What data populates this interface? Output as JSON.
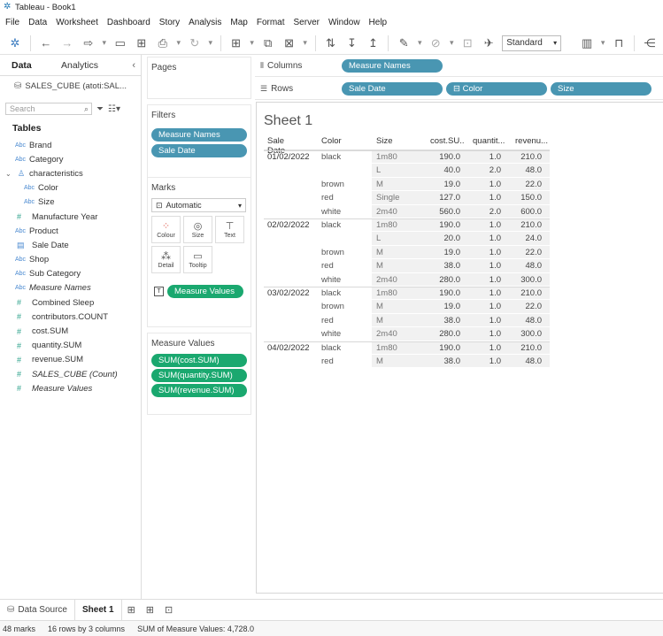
{
  "window": {
    "title": "Tableau - Book1"
  },
  "menu": [
    "File",
    "Data",
    "Worksheet",
    "Dashboard",
    "Story",
    "Analysis",
    "Map",
    "Format",
    "Server",
    "Window",
    "Help"
  ],
  "toolbar": {
    "fit_select": "Standard"
  },
  "left_pane": {
    "tabs": {
      "data": "Data",
      "analytics": "Analytics"
    },
    "datasource": "SALES_CUBE (atoti:SAL...",
    "search_placeholder": "Search",
    "tables_header": "Tables",
    "fields": [
      {
        "type": "Abc",
        "name": "Brand"
      },
      {
        "type": "Abc",
        "name": "Category"
      },
      {
        "type": "hier",
        "name": "characteristics"
      },
      {
        "type": "Abc",
        "name": "Color",
        "child": true
      },
      {
        "type": "Abc",
        "name": "Size",
        "child": true
      },
      {
        "type": "#",
        "name": "Manufacture Year"
      },
      {
        "type": "Abc",
        "name": "Product"
      },
      {
        "type": "date",
        "name": "Sale Date"
      },
      {
        "type": "Abc",
        "name": "Shop"
      },
      {
        "type": "Abc",
        "name": "Sub Category"
      },
      {
        "type": "Abc",
        "name": "Measure Names",
        "italic": true
      },
      {
        "type": "#",
        "name": "Combined Sleep"
      },
      {
        "type": "#",
        "name": "contributors.COUNT"
      },
      {
        "type": "#",
        "name": "cost.SUM"
      },
      {
        "type": "#",
        "name": "quantity.SUM"
      },
      {
        "type": "#",
        "name": "revenue.SUM"
      },
      {
        "type": "#",
        "name": "SALES_CUBE (Count)",
        "italic": true
      },
      {
        "type": "#",
        "name": "Measure Values",
        "italic": true
      }
    ]
  },
  "pages": {
    "title": "Pages"
  },
  "filters": {
    "title": "Filters",
    "items": [
      "Measure Names",
      "Sale Date"
    ]
  },
  "marks": {
    "title": "Marks",
    "type": "Automatic",
    "buttons": [
      "Colour",
      "Size",
      "Text",
      "Detail",
      "Tooltip"
    ],
    "text_pill": "Measure Values"
  },
  "measure_values": {
    "title": "Measure Values",
    "items": [
      "SUM(cost.SUM)",
      "SUM(quantity.SUM)",
      "SUM(revenue.SUM)"
    ]
  },
  "columns": {
    "label": "Columns",
    "pills": [
      "Measure Names"
    ]
  },
  "rows": {
    "label": "Rows",
    "pills": [
      "Sale Date",
      "⊟ Color",
      "Size"
    ]
  },
  "sheet": {
    "title": "Sheet 1",
    "headers": [
      "Sale Date",
      "Color",
      "Size",
      "cost.SU..",
      "quantit...",
      "revenu..."
    ],
    "rows": [
      {
        "date": "01/02/2022",
        "color": "black",
        "size": "1m80",
        "cost": "190.0",
        "qty": "1.0",
        "rev": "210.0"
      },
      {
        "date": "",
        "color": "",
        "size": "L",
        "cost": "40.0",
        "qty": "2.0",
        "rev": "48.0"
      },
      {
        "date": "",
        "color": "brown",
        "size": "M",
        "cost": "19.0",
        "qty": "1.0",
        "rev": "22.0"
      },
      {
        "date": "",
        "color": "red",
        "size": "Single",
        "cost": "127.0",
        "qty": "1.0",
        "rev": "150.0"
      },
      {
        "date": "",
        "color": "white",
        "size": "2m40",
        "cost": "560.0",
        "qty": "2.0",
        "rev": "600.0"
      },
      {
        "date": "02/02/2022",
        "color": "black",
        "size": "1m80",
        "cost": "190.0",
        "qty": "1.0",
        "rev": "210.0"
      },
      {
        "date": "",
        "color": "",
        "size": "L",
        "cost": "20.0",
        "qty": "1.0",
        "rev": "24.0"
      },
      {
        "date": "",
        "color": "brown",
        "size": "M",
        "cost": "19.0",
        "qty": "1.0",
        "rev": "22.0"
      },
      {
        "date": "",
        "color": "red",
        "size": "M",
        "cost": "38.0",
        "qty": "1.0",
        "rev": "48.0"
      },
      {
        "date": "",
        "color": "white",
        "size": "2m40",
        "cost": "280.0",
        "qty": "1.0",
        "rev": "300.0"
      },
      {
        "date": "03/02/2022",
        "color": "black",
        "size": "1m80",
        "cost": "190.0",
        "qty": "1.0",
        "rev": "210.0"
      },
      {
        "date": "",
        "color": "brown",
        "size": "M",
        "cost": "19.0",
        "qty": "1.0",
        "rev": "22.0"
      },
      {
        "date": "",
        "color": "red",
        "size": "M",
        "cost": "38.0",
        "qty": "1.0",
        "rev": "48.0"
      },
      {
        "date": "",
        "color": "white",
        "size": "2m40",
        "cost": "280.0",
        "qty": "1.0",
        "rev": "300.0"
      },
      {
        "date": "04/02/2022",
        "color": "black",
        "size": "1m80",
        "cost": "190.0",
        "qty": "1.0",
        "rev": "210.0"
      },
      {
        "date": "",
        "color": "red",
        "size": "M",
        "cost": "38.0",
        "qty": "1.0",
        "rev": "48.0"
      }
    ]
  },
  "bottom_tabs": {
    "data_source": "Data Source",
    "sheet": "Sheet 1"
  },
  "status": {
    "marks": "48 marks",
    "dims": "16 rows by 3 columns",
    "sum": "SUM of Measure Values: 4,728.0"
  },
  "colors": {
    "pill_blue": "#4996b2",
    "pill_green": "#1aa86f"
  }
}
